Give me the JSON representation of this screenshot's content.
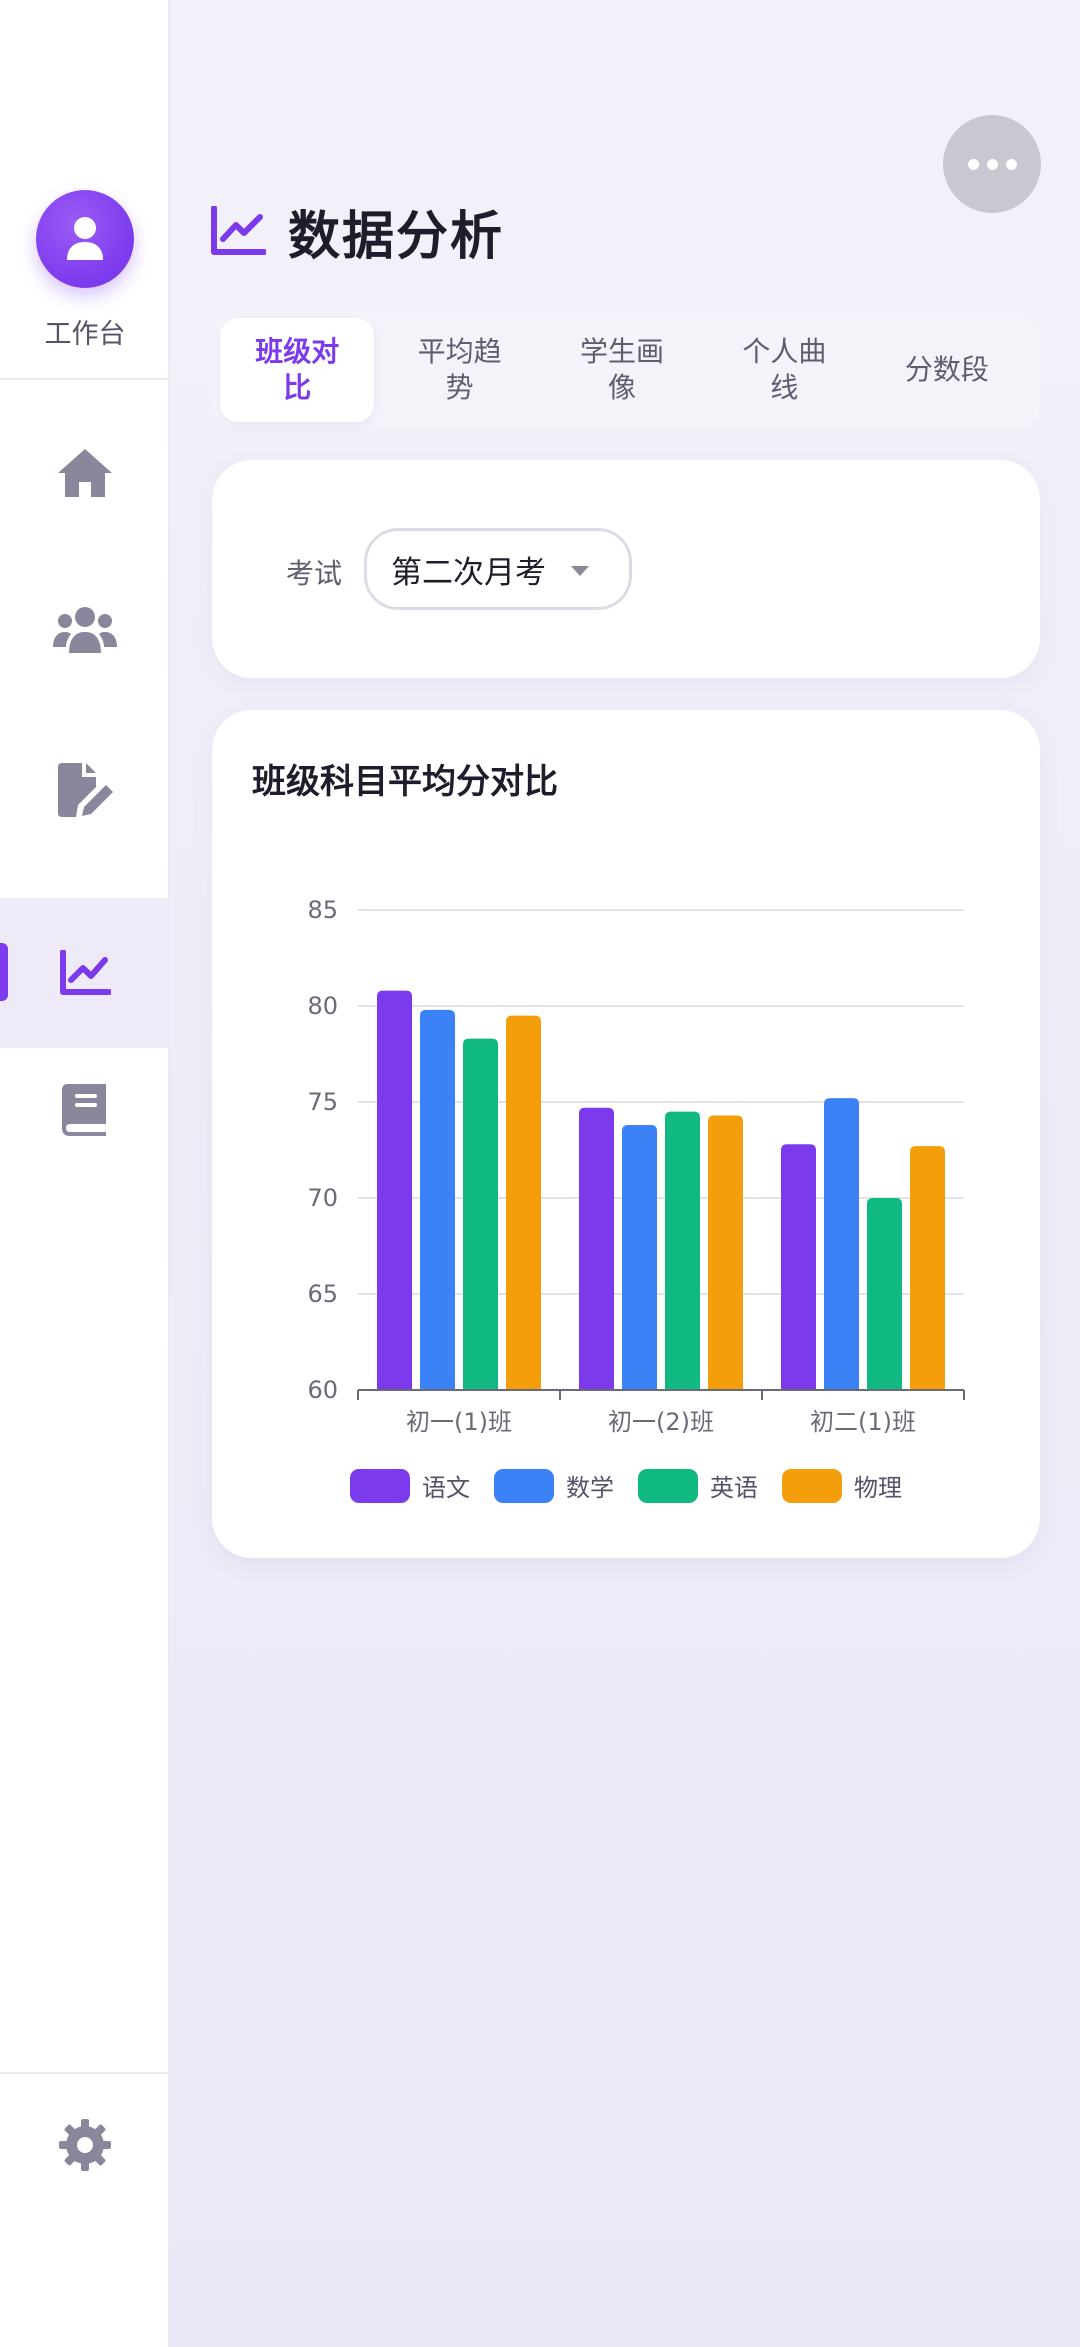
{
  "sidebar": {
    "workbench_label": "工作台",
    "nav": [
      {
        "icon": "home-icon",
        "active": false
      },
      {
        "icon": "users-icon",
        "active": false
      },
      {
        "icon": "file-edit-icon",
        "active": false
      },
      {
        "icon": "chart-line-icon",
        "active": true
      },
      {
        "icon": "book-icon",
        "active": false
      }
    ],
    "settings_icon": "gear-icon"
  },
  "header": {
    "title": "数据分析",
    "icon": "chart-line-icon",
    "more_icon": "more-dots-icon"
  },
  "tabs": [
    {
      "label": "班级对比",
      "active": true
    },
    {
      "label": "平均趋势",
      "active": false
    },
    {
      "label": "学生画像",
      "active": false
    },
    {
      "label": "个人曲线",
      "active": false
    },
    {
      "label": "分数段",
      "active": false
    }
  ],
  "filter": {
    "label": "考试",
    "selected_exam": "第二次月考"
  },
  "colors": {
    "accent": "#7c3aed"
  },
  "chart_data": {
    "type": "bar",
    "title": "班级科目平均分对比",
    "categories": [
      "初一(1)班",
      "初一(2)班",
      "初二(1)班"
    ],
    "series": [
      {
        "name": "语文",
        "color": "#7c3aed",
        "values": [
          80.8,
          74.7,
          72.8
        ]
      },
      {
        "name": "数学",
        "color": "#3b82f6",
        "values": [
          79.8,
          73.8,
          75.2
        ]
      },
      {
        "name": "英语",
        "color": "#10b981",
        "values": [
          78.3,
          74.5,
          70.0
        ]
      },
      {
        "name": "物理",
        "color": "#f59e0b",
        "values": [
          79.5,
          74.3,
          72.7
        ]
      }
    ],
    "ylim": [
      60,
      85
    ],
    "yticks": [
      60,
      65,
      70,
      75,
      80,
      85
    ],
    "grid": true,
    "legend_position": "bottom"
  }
}
